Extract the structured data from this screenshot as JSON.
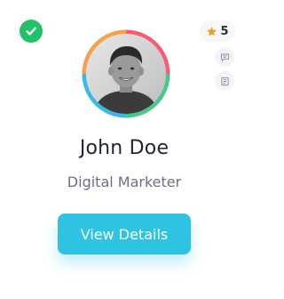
{
  "profile": {
    "name": "John Doe",
    "role": "Digital Marketer",
    "rating": "5",
    "verified": true,
    "icons": {
      "verified": "check-circle-icon",
      "rating": "star-icon",
      "message": "message-icon",
      "document": "document-icon"
    },
    "ring_colors": [
      "#f25f73",
      "#48c98a",
      "#3ab8ea",
      "#f6a04a"
    ]
  },
  "actions": {
    "view_details_label": "View Details"
  },
  "colors": {
    "accent": "#2ec2e3",
    "verified": "#22c06b",
    "star": "#f39a2a"
  }
}
